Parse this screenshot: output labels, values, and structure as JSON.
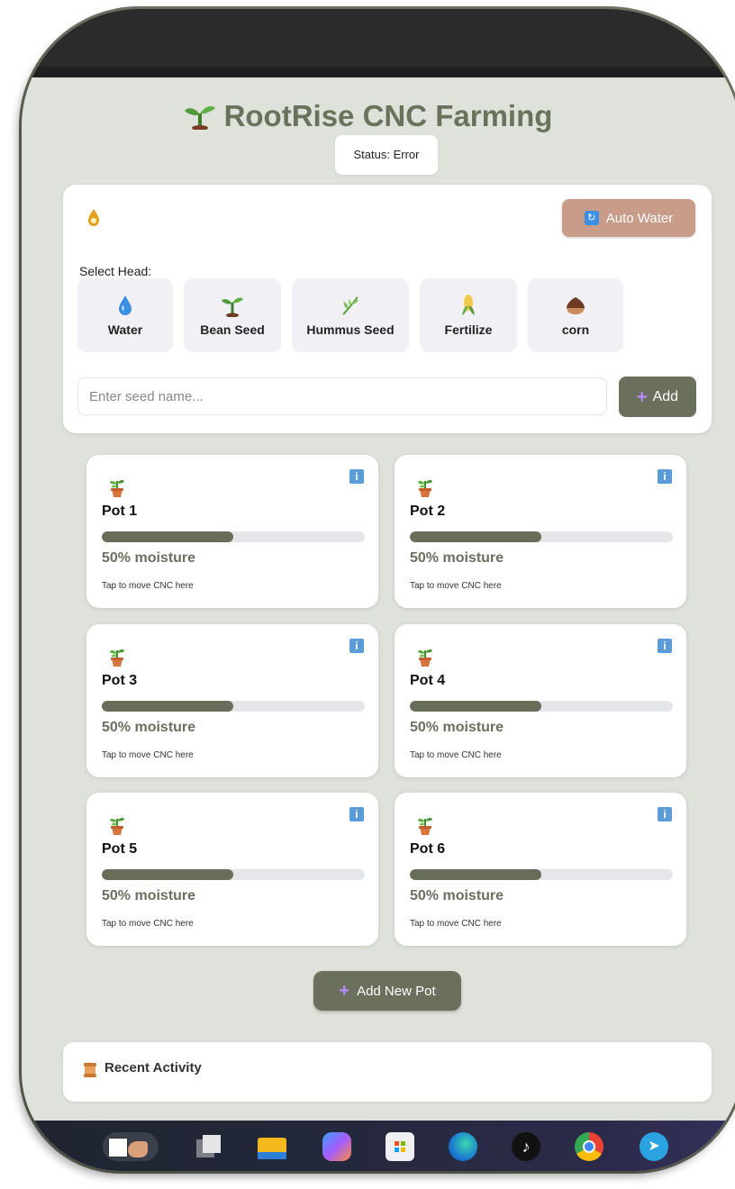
{
  "app": {
    "title": "RootRise CNC Farming",
    "status": "Status: Error"
  },
  "controls": {
    "auto_water_label": "Auto Water",
    "select_head_label": "Select Head:",
    "heads": [
      {
        "label": "Water",
        "icon": "water-drop-icon"
      },
      {
        "label": "Bean Seed",
        "icon": "seedling-icon"
      },
      {
        "label": "Hummus Seed",
        "icon": "herb-icon"
      },
      {
        "label": "Fertilize",
        "icon": "corn-icon"
      },
      {
        "label": "corn",
        "icon": "chestnut-icon"
      }
    ],
    "seed_placeholder": "Enter seed name...",
    "add_label": "Add"
  },
  "pots": [
    {
      "name": "Pot 1",
      "moisture_pct": 50,
      "moisture_text": "50% moisture",
      "hint": "Tap to move CNC here"
    },
    {
      "name": "Pot 2",
      "moisture_pct": 50,
      "moisture_text": "50% moisture",
      "hint": "Tap to move CNC here"
    },
    {
      "name": "Pot 3",
      "moisture_pct": 50,
      "moisture_text": "50% moisture",
      "hint": "Tap to move CNC here"
    },
    {
      "name": "Pot 4",
      "moisture_pct": 50,
      "moisture_text": "50% moisture",
      "hint": "Tap to move CNC here"
    },
    {
      "name": "Pot 5",
      "moisture_pct": 50,
      "moisture_text": "50% moisture",
      "hint": "Tap to move CNC here"
    },
    {
      "name": "Pot 6",
      "moisture_pct": 50,
      "moisture_text": "50% moisture",
      "hint": "Tap to move CNC here"
    }
  ],
  "add_pot_label": "Add New Pot",
  "activity": {
    "title": "Recent Activity"
  },
  "taskbar": {
    "apps": [
      "sudoku-icon",
      "task-view-icon",
      "file-explorer-icon",
      "copilot-icon",
      "store-icon",
      "edge-icon",
      "tiktok-icon",
      "chrome-icon",
      "telegram-icon"
    ]
  },
  "colors": {
    "accent": "#6a705c",
    "auto_water": "#c89c88",
    "title": "#6a725c",
    "background": "#dfe2da"
  }
}
